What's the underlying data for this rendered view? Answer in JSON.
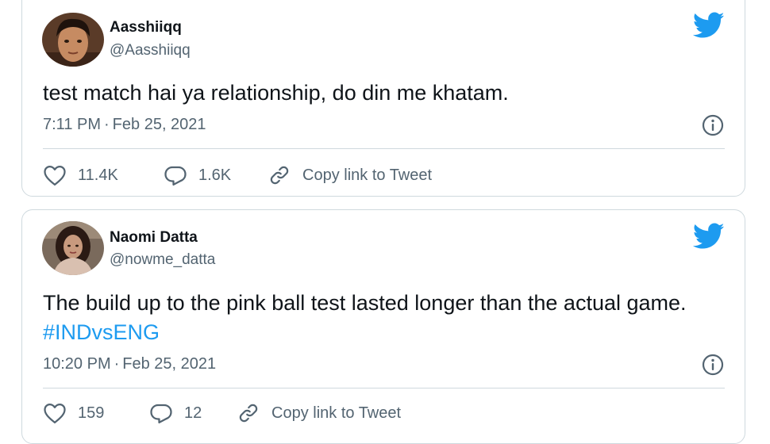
{
  "tweets": [
    {
      "author_name": "Aasshiiqq",
      "author_handle": "@Aasshiiqq",
      "text": "test match hai ya relationship, do din me khatam.",
      "time": "7:11 PM",
      "date": "Feb 25, 2021",
      "separator": "·",
      "likes": "11.4K",
      "replies": "1.6K",
      "copy_link_label": "Copy link to Tweet"
    },
    {
      "author_name": "Naomi Datta",
      "author_handle": "@nowme_datta",
      "text": "The build up to the pink ball test lasted longer than the actual game. ",
      "hashtag": "#INDvsENG",
      "time": "10:20 PM",
      "date": "Feb 25, 2021",
      "separator": "·",
      "likes": "159",
      "replies": "12",
      "copy_link_label": "Copy link to Tweet"
    }
  ],
  "colors": {
    "twitter_blue": "#1d9bf0",
    "text_primary": "#0f1419",
    "text_secondary": "#536471",
    "border": "#cfd9de"
  },
  "icons": [
    "twitter-bird-icon",
    "info-icon",
    "heart-icon",
    "reply-bubble-icon",
    "link-icon"
  ]
}
